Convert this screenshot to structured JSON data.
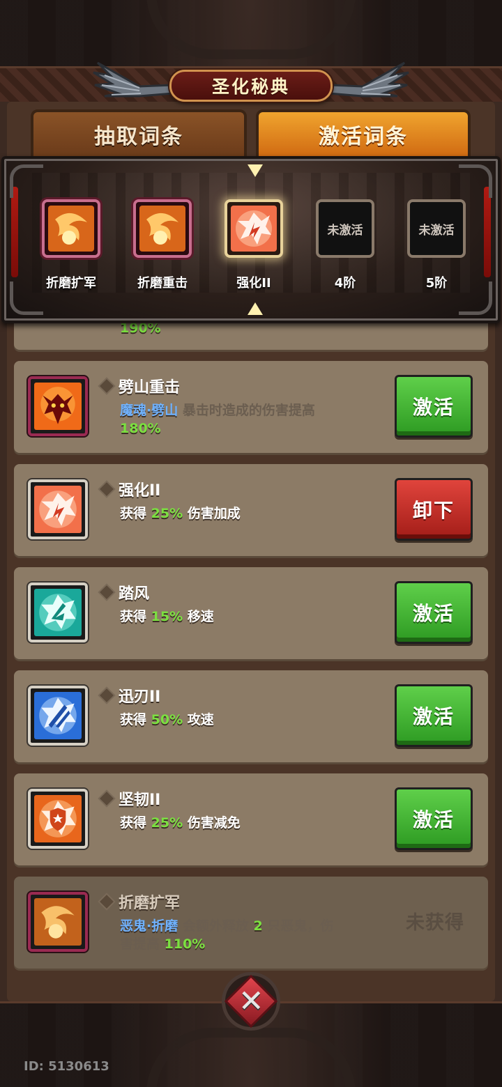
{
  "title": "圣化秘典",
  "tabs": [
    {
      "label": "抽取词条",
      "active": false
    },
    {
      "label": "激活词条",
      "active": true
    }
  ],
  "slots": [
    {
      "label": "折磨扩军",
      "state": "owned",
      "icon": "demon-fire-icon"
    },
    {
      "label": "折磨重击",
      "state": "owned",
      "icon": "demon-fire-icon"
    },
    {
      "label": "强化II",
      "state": "selected",
      "icon": "strength-icon"
    },
    {
      "label": "4阶",
      "state": "locked",
      "lock_text": "未激活"
    },
    {
      "label": "5阶",
      "state": "locked",
      "lock_text": "未激活"
    }
  ],
  "cards": [
    {
      "name": "",
      "desc_partial": "190%",
      "action": "激活",
      "action_type": "green"
    },
    {
      "name": "劈山重击",
      "tag": "魔魂·劈山",
      "desc": "暴击时造成的伤害提高",
      "value": "180%",
      "action": "激活",
      "action_type": "green",
      "icon": "demon-icon"
    },
    {
      "name": "强化II",
      "prefix": "获得",
      "value": "25%",
      "suffix": "伤害加成",
      "action": "卸下",
      "action_type": "red",
      "icon": "strength-icon"
    },
    {
      "name": "踏风",
      "prefix": "获得",
      "value": "15%",
      "suffix": "移速",
      "action": "激活",
      "action_type": "green",
      "icon": "wind-icon"
    },
    {
      "name": "迅刃II",
      "prefix": "获得",
      "value": "50%",
      "suffix": "攻速",
      "action": "激活",
      "action_type": "green",
      "icon": "blade-icon"
    },
    {
      "name": "坚韧II",
      "prefix": "获得",
      "value": "25%",
      "suffix": "伤害减免",
      "action": "激活",
      "action_type": "green",
      "icon": "shield-icon"
    },
    {
      "name": "折磨扩军",
      "tag": "恶鬼·折磨",
      "desc1": "会额外释放",
      "count": "2",
      "desc2": "只恶鬼，伤",
      "desc3": "害提高",
      "value": "110%",
      "status": "未获得",
      "icon": "demon-fire-icon"
    }
  ],
  "user_id": "ID: 5130613",
  "colors": {
    "green": "#2d9a22",
    "red": "#a31d18",
    "gold": "#d1934f",
    "value_green": "#7be040",
    "tag_blue": "#6fb2ff"
  }
}
